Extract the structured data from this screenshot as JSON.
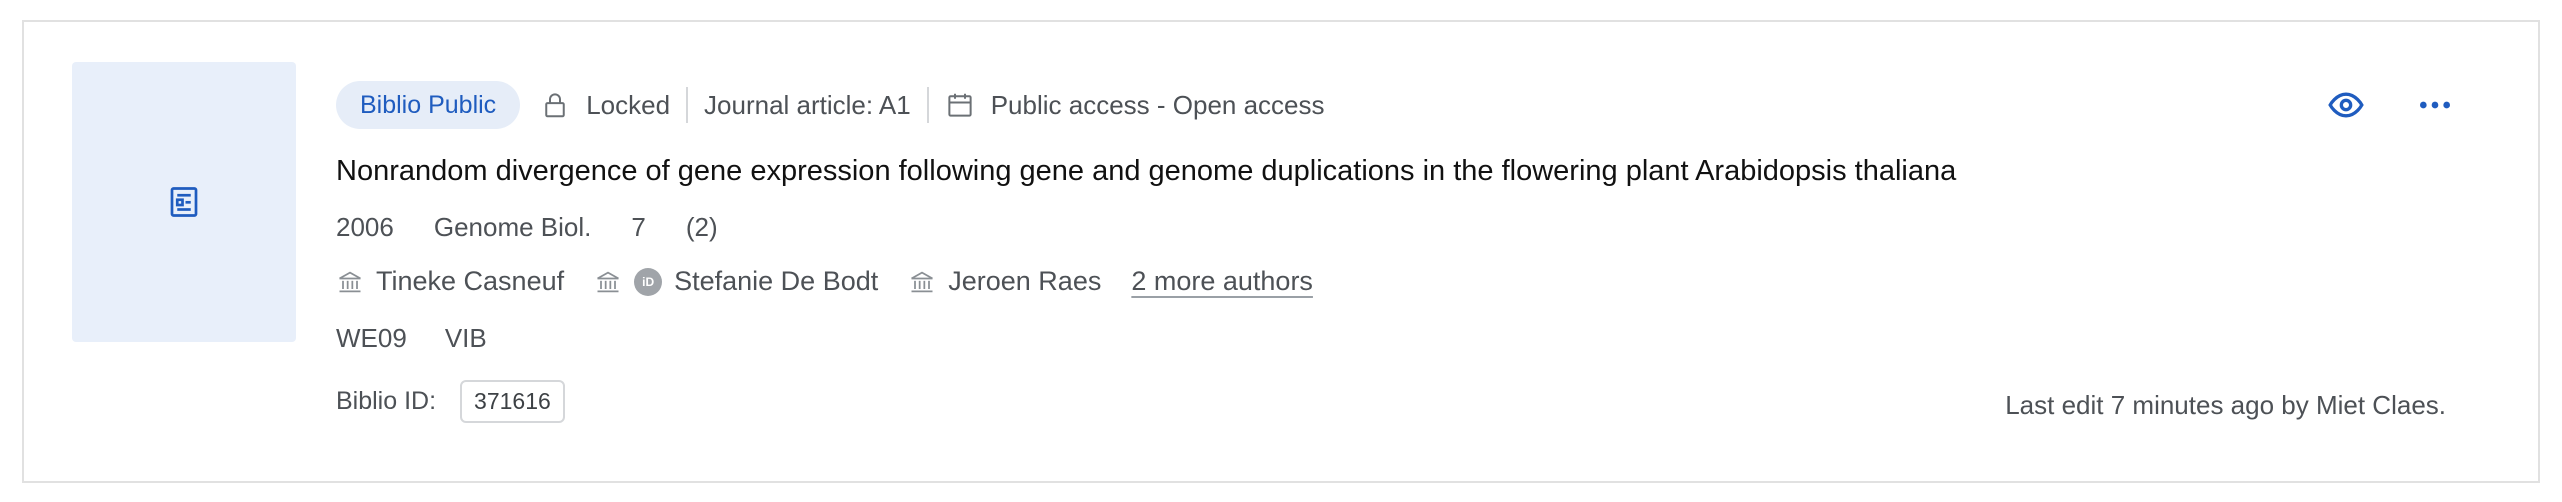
{
  "colors": {
    "accent": "#1f5cbf",
    "thumb_bg": "#e8effa",
    "badge_bg": "#e6edf8"
  },
  "badge": "Biblio Public",
  "lock_label": "Locked",
  "type_label": "Journal article: A1",
  "access_label": "Public access - Open access",
  "title": "Nonrandom divergence of gene expression following gene and genome duplications in the flowering plant Arabidopsis thaliana",
  "details": {
    "year": "2006",
    "journal": "Genome Biol.",
    "volume": "7",
    "issue": "(2)"
  },
  "authors": [
    {
      "name": "Tineke Casneuf",
      "orcid": false
    },
    {
      "name": "Stefanie De Bodt",
      "orcid": true,
      "orcid_label": "iD"
    },
    {
      "name": "Jeroen Raes",
      "orcid": false
    }
  ],
  "more_authors": "2 more authors",
  "departments": [
    "WE09",
    "VIB"
  ],
  "biblio_id_label": "Biblio ID:",
  "biblio_id": "371616",
  "last_edit": "Last edit 7 minutes ago by Miet Claes.",
  "icons": {
    "thumb": "document-icon",
    "lock": "lock-icon",
    "calendar": "calendar-icon",
    "affiliation": "building-icon",
    "view": "eye-icon",
    "more": "more-options-icon"
  }
}
